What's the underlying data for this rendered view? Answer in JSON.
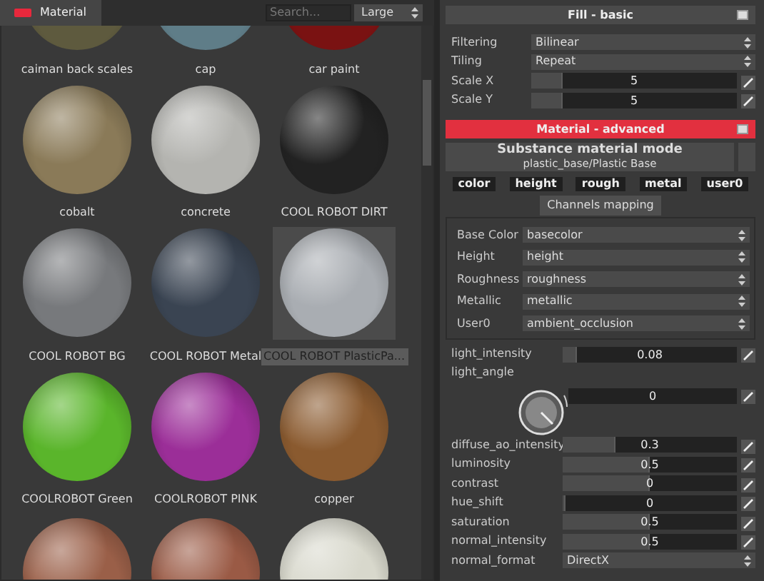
{
  "library": {
    "tab": {
      "label": "Material"
    },
    "search": {
      "placeholder": "Search..."
    },
    "size_select": {
      "value": "Large"
    },
    "materials": [
      {
        "name": "caiman back scales",
        "color": "#5e5a3e",
        "selected": false
      },
      {
        "name": "cap",
        "color": "#5f7d88",
        "selected": false
      },
      {
        "name": "car paint",
        "color": "#7a1212",
        "selected": false
      },
      {
        "name": "cobalt",
        "color": "#8a7a58",
        "selected": false
      },
      {
        "name": "concrete",
        "color": "#b4b4b0",
        "selected": false
      },
      {
        "name": "COOL ROBOT DIRT",
        "color": "#222222",
        "selected": false
      },
      {
        "name": "COOL ROBOT BG",
        "color": "#77797c",
        "selected": false
      },
      {
        "name": "COOL ROBOT Metal",
        "color": "#3a4452",
        "selected": false
      },
      {
        "name": "COOL ROBOT PlasticPa...",
        "color": "#a9adb2",
        "selected": true
      },
      {
        "name": "COOLROBOT Green",
        "color": "#5ab52b",
        "selected": false
      },
      {
        "name": "COOLROBOT PINK",
        "color": "#9b2e98",
        "selected": false
      },
      {
        "name": "copper",
        "color": "#8a5a2f",
        "selected": false
      },
      {
        "color": "#9a5f48",
        "selected": false
      },
      {
        "color": "#9a5a45",
        "selected": false
      },
      {
        "color": "#d8d8cc",
        "selected": false
      }
    ]
  },
  "fill_basic": {
    "title": "Fill - basic",
    "rows": [
      {
        "kind": "select",
        "label": "Filtering",
        "value": "Bilinear"
      },
      {
        "kind": "select",
        "label": "Tiling",
        "value": "Repeat"
      },
      {
        "kind": "slider",
        "label": "Scale X",
        "value": "5",
        "level": 0.15
      },
      {
        "kind": "slider",
        "label": "Scale Y",
        "value": "5",
        "level": 0.15
      }
    ]
  },
  "material_advanced": {
    "title": "Material - advanced",
    "mode_button": {
      "title": "Substance material mode",
      "subtitle": "plastic_base/Plastic Base"
    },
    "channels": [
      "color",
      "height",
      "rough",
      "metal",
      "user0"
    ],
    "channels_mapping_button": "Channels mapping",
    "mapping": [
      {
        "label": "Base Color",
        "value": "basecolor"
      },
      {
        "label": "Height",
        "value": "height"
      },
      {
        "label": "Roughness",
        "value": "roughness"
      },
      {
        "label": "Metallic",
        "value": "metallic"
      },
      {
        "label": "User0",
        "value": "ambient_occlusion"
      }
    ],
    "params": [
      {
        "kind": "slider",
        "label": "light_intensity",
        "value": "0.08",
        "level": 0.08
      },
      {
        "kind": "knob",
        "label": "light_angle",
        "value": "0"
      },
      {
        "kind": "slider",
        "label": "diffuse_ao_intensity",
        "value": "0.3",
        "level": 0.3
      },
      {
        "kind": "slider",
        "label": "luminosity",
        "value": "0.5",
        "level": 0.5
      },
      {
        "kind": "slider",
        "label": "contrast",
        "value": "0",
        "level": 0.5
      },
      {
        "kind": "slider",
        "label": "hue_shift",
        "value": "0",
        "level": 0
      },
      {
        "kind": "slider",
        "label": "saturation",
        "value": "0.5",
        "level": 0.5
      },
      {
        "kind": "slider",
        "label": "normal_intensity",
        "value": "0.5",
        "level": 0.5
      },
      {
        "kind": "select",
        "label": "normal_format",
        "value": "DirectX"
      }
    ]
  }
}
